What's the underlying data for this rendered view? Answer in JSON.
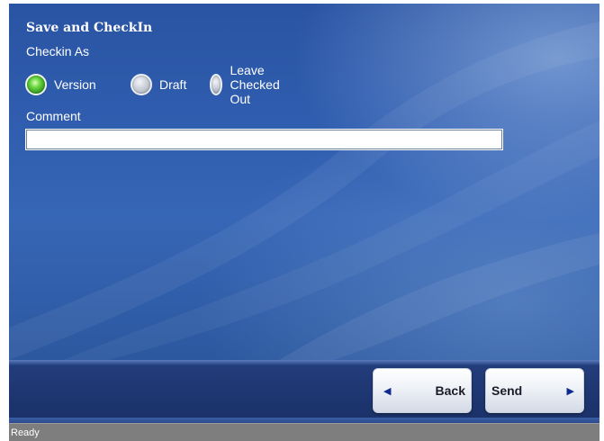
{
  "dialog": {
    "title": "Save and CheckIn",
    "checkin_as_label": "Checkin As",
    "comment_label": "Comment"
  },
  "checkin_options": [
    {
      "label": "Version",
      "selected": true
    },
    {
      "label": "Draft",
      "selected": false
    },
    {
      "label": "Leave Checked Out",
      "selected": false
    }
  ],
  "comment": {
    "value": "",
    "placeholder": ""
  },
  "nav": {
    "back_label": "Back",
    "send_label": "Send",
    "back_icon": "left-triangle-icon",
    "send_icon": "right-triangle-icon"
  },
  "status": {
    "text": "Ready"
  },
  "colors": {
    "panel_blue": "#2f5cae",
    "nav_band": "#1e3772",
    "status_bar": "#7e7e7e",
    "selected_radio": "#66d43b"
  }
}
